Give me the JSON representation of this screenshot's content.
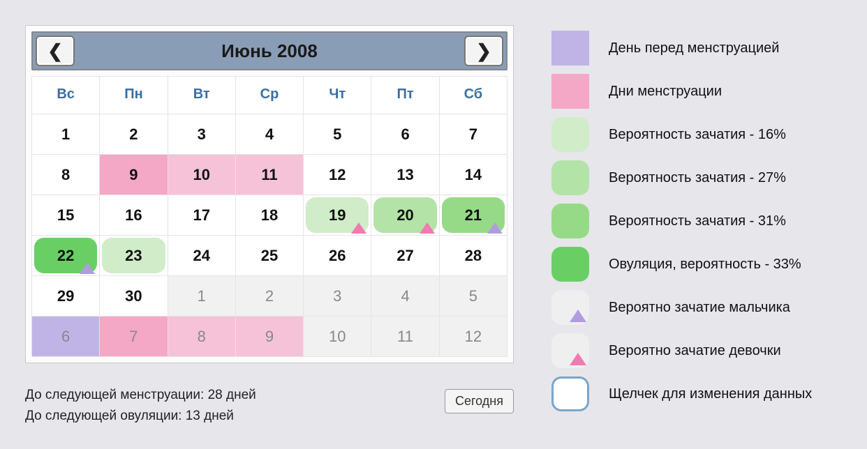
{
  "header": {
    "month_title": "Июнь 2008"
  },
  "weekdays": [
    "Вс",
    "Пн",
    "Вт",
    "Ср",
    "Чт",
    "Пт",
    "Сб"
  ],
  "weeks": [
    [
      {
        "n": "1"
      },
      {
        "n": "2"
      },
      {
        "n": "3"
      },
      {
        "n": "4"
      },
      {
        "n": "5"
      },
      {
        "n": "6"
      },
      {
        "n": "7"
      }
    ],
    [
      {
        "n": "8"
      },
      {
        "n": "9",
        "shade": "menst",
        "selected": true
      },
      {
        "n": "10",
        "shade": "menst2"
      },
      {
        "n": "11",
        "shade": "menst2"
      },
      {
        "n": "12"
      },
      {
        "n": "13"
      },
      {
        "n": "14"
      }
    ],
    [
      {
        "n": "15"
      },
      {
        "n": "16"
      },
      {
        "n": "17"
      },
      {
        "n": "18"
      },
      {
        "n": "19",
        "shade": "fert16",
        "tri": "girl"
      },
      {
        "n": "20",
        "shade": "fert27",
        "tri": "girl"
      },
      {
        "n": "21",
        "shade": "fert31",
        "tri": "boy"
      }
    ],
    [
      {
        "n": "22",
        "shade": "ovul",
        "tri": "boy"
      },
      {
        "n": "23",
        "shade": "fert16"
      },
      {
        "n": "24"
      },
      {
        "n": "25"
      },
      {
        "n": "26"
      },
      {
        "n": "27"
      },
      {
        "n": "28"
      }
    ],
    [
      {
        "n": "29"
      },
      {
        "n": "30"
      },
      {
        "n": "1",
        "other": true
      },
      {
        "n": "2",
        "other": true
      },
      {
        "n": "3",
        "other": true
      },
      {
        "n": "4",
        "other": true
      },
      {
        "n": "5",
        "other": true
      }
    ],
    [
      {
        "n": "6",
        "other": true,
        "shade": "premenst"
      },
      {
        "n": "7",
        "other": true,
        "shade": "menst"
      },
      {
        "n": "8",
        "other": true,
        "shade": "menst2"
      },
      {
        "n": "9",
        "other": true,
        "shade": "menst2"
      },
      {
        "n": "10",
        "other": true
      },
      {
        "n": "11",
        "other": true
      },
      {
        "n": "12",
        "other": true
      }
    ]
  ],
  "footer": {
    "line1": "До следующей менструации: 28 дней",
    "line2": "До следующей овуляции: 13 дней",
    "today_label": "Сегодня"
  },
  "legend": [
    {
      "label": "День перед менструацией",
      "swatch": "premenst",
      "square": true
    },
    {
      "label": "Дни менструации",
      "swatch": "menst",
      "square": true
    },
    {
      "label": "Вероятность зачатия - 16%",
      "swatch": "fert16"
    },
    {
      "label": "Вероятность зачатия - 27%",
      "swatch": "fert27"
    },
    {
      "label": "Вероятность зачатия - 31%",
      "swatch": "fert31"
    },
    {
      "label": "Овуляция, вероятность - 33%",
      "swatch": "ovul"
    },
    {
      "label": "Вероятно зачатие мальчика",
      "swatch": "plain",
      "tri": "boy"
    },
    {
      "label": "Вероятно зачатие девочки",
      "swatch": "plain",
      "tri": "girl"
    },
    {
      "label": "Щелчек для изменения данных",
      "swatch": "outlined"
    }
  ],
  "colors": {
    "premenst": "#c0b4e6",
    "menst": "#f5a7c6",
    "menst2": "#f6c2d8",
    "fert16": "#d0ecc9",
    "fert27": "#b4e3a8",
    "fert31": "#96da87",
    "ovul": "#69cf65",
    "plain": "#efefef"
  }
}
